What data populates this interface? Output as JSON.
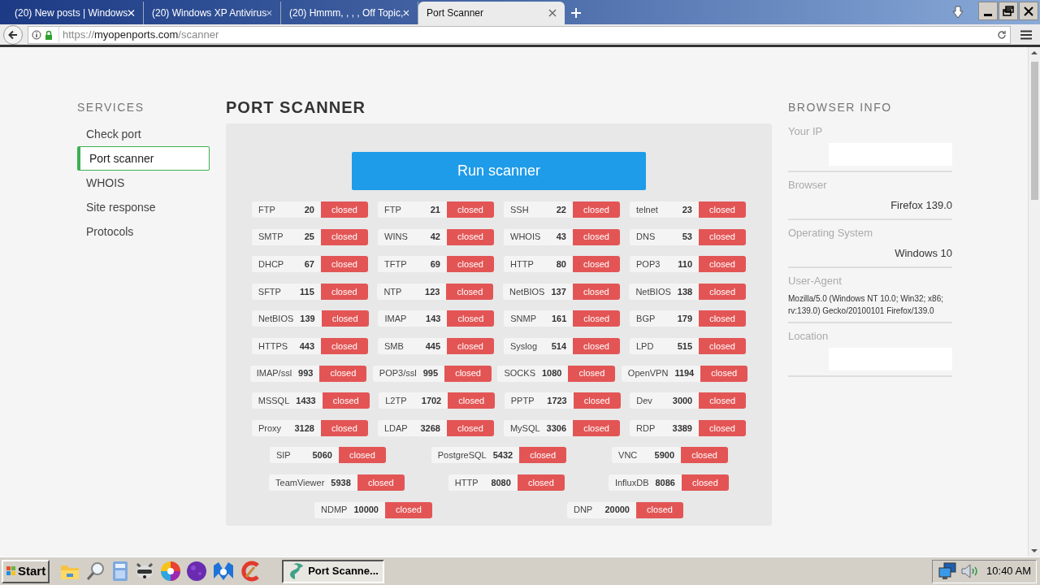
{
  "browser": {
    "tabs": [
      {
        "title": "(20) New posts | Windows",
        "selected": false
      },
      {
        "title": "(20) Windows XP Antivirus",
        "selected": false
      },
      {
        "title": "(20) Hmmm, , , , Off Topic,",
        "selected": false
      },
      {
        "title": "Port Scanner",
        "selected": true
      }
    ],
    "url": {
      "scheme": "https://",
      "host": "myopenports.com",
      "path": "/scanner"
    }
  },
  "sidebar": {
    "heading": "SERVICES",
    "items": [
      {
        "label": "Check port",
        "selected": false
      },
      {
        "label": "Port scanner",
        "selected": true
      },
      {
        "label": "WHOIS",
        "selected": false
      },
      {
        "label": "Site response",
        "selected": false
      },
      {
        "label": "Protocols",
        "selected": false
      }
    ]
  },
  "main": {
    "title": "PORT SCANNER",
    "run_button": "Run scanner",
    "port_rows": [
      [
        {
          "service": "FTP",
          "port": "20",
          "status": "closed"
        },
        {
          "service": "FTP",
          "port": "21",
          "status": "closed"
        },
        {
          "service": "SSH",
          "port": "22",
          "status": "closed"
        },
        {
          "service": "telnet",
          "port": "23",
          "status": "closed"
        }
      ],
      [
        {
          "service": "SMTP",
          "port": "25",
          "status": "closed"
        },
        {
          "service": "WINS",
          "port": "42",
          "status": "closed"
        },
        {
          "service": "WHOIS",
          "port": "43",
          "status": "closed"
        },
        {
          "service": "DNS",
          "port": "53",
          "status": "closed"
        }
      ],
      [
        {
          "service": "DHCP",
          "port": "67",
          "status": "closed"
        },
        {
          "service": "TFTP",
          "port": "69",
          "status": "closed"
        },
        {
          "service": "HTTP",
          "port": "80",
          "status": "closed"
        },
        {
          "service": "POP3",
          "port": "110",
          "status": "closed"
        }
      ],
      [
        {
          "service": "SFTP",
          "port": "115",
          "status": "closed"
        },
        {
          "service": "NTP",
          "port": "123",
          "status": "closed"
        },
        {
          "service": "NetBIOS",
          "port": "137",
          "status": "closed"
        },
        {
          "service": "NetBIOS",
          "port": "138",
          "status": "closed"
        }
      ],
      [
        {
          "service": "NetBIOS",
          "port": "139",
          "status": "closed"
        },
        {
          "service": "IMAP",
          "port": "143",
          "status": "closed"
        },
        {
          "service": "SNMP",
          "port": "161",
          "status": "closed"
        },
        {
          "service": "BGP",
          "port": "179",
          "status": "closed"
        }
      ],
      [
        {
          "service": "HTTPS",
          "port": "443",
          "status": "closed"
        },
        {
          "service": "SMB",
          "port": "445",
          "status": "closed"
        },
        {
          "service": "Syslog",
          "port": "514",
          "status": "closed"
        },
        {
          "service": "LPD",
          "port": "515",
          "status": "closed"
        }
      ],
      [
        {
          "service": "IMAP/ssl",
          "port": "993",
          "status": "closed"
        },
        {
          "service": "POP3/ssl",
          "port": "995",
          "status": "closed"
        },
        {
          "service": "SOCKS",
          "port": "1080",
          "status": "closed"
        },
        {
          "service": "OpenVPN",
          "port": "1194",
          "status": "closed"
        }
      ],
      [
        {
          "service": "MSSQL",
          "port": "1433",
          "status": "closed"
        },
        {
          "service": "L2TP",
          "port": "1702",
          "status": "closed"
        },
        {
          "service": "PPTP",
          "port": "1723",
          "status": "closed"
        },
        {
          "service": "Dev",
          "port": "3000",
          "status": "closed"
        }
      ],
      [
        {
          "service": "Proxy",
          "port": "3128",
          "status": "closed"
        },
        {
          "service": "LDAP",
          "port": "3268",
          "status": "closed"
        },
        {
          "service": "MySQL",
          "port": "3306",
          "status": "closed"
        },
        {
          "service": "RDP",
          "port": "3389",
          "status": "closed"
        }
      ],
      [
        {
          "service": "SIP",
          "port": "5060",
          "status": "closed"
        },
        {
          "service": "PostgreSQL",
          "port": "5432",
          "status": "closed"
        },
        {
          "service": "VNC",
          "port": "5900",
          "status": "closed"
        }
      ],
      [
        {
          "service": "TeamViewer",
          "port": "5938",
          "status": "closed"
        },
        {
          "service": "HTTP",
          "port": "8080",
          "status": "closed"
        },
        {
          "service": "InfluxDB",
          "port": "8086",
          "status": "closed"
        }
      ],
      [
        {
          "service": "NDMP",
          "port": "10000",
          "status": "closed"
        },
        {
          "service": "DNP",
          "port": "20000",
          "status": "closed"
        }
      ]
    ]
  },
  "browser_info": {
    "heading": "BROWSER INFO",
    "fields": [
      {
        "label": "Your IP",
        "kind": "redacted"
      },
      {
        "label": "Browser",
        "kind": "value",
        "value": "Firefox 139.0"
      },
      {
        "label": "Operating System",
        "kind": "value",
        "value": "Windows 10"
      },
      {
        "label": "User-Agent",
        "kind": "small",
        "value": "Mozilla/5.0 (Windows NT 10.0; Win32; x86; rv:139.0) Gecko/20100101 Firefox/139.0"
      },
      {
        "label": "Location",
        "kind": "redacted"
      }
    ]
  },
  "taskbar": {
    "start": "Start",
    "window_button": {
      "label": "Port Scanne...",
      "selected": true
    },
    "clock": "10:40 AM"
  }
}
